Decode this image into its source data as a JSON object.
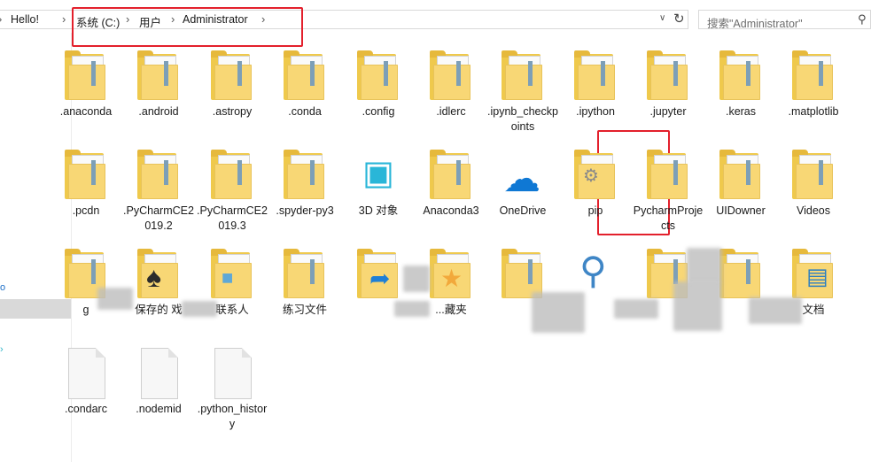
{
  "breadcrumb": {
    "root": "Hello!",
    "drive": "系统 (C:)",
    "users": "用户",
    "folder": "Administrator"
  },
  "search": {
    "placeholder": "搜索\"Administrator\""
  },
  "items": [
    {
      "name": ".anaconda",
      "icon": "folder-icon"
    },
    {
      "name": ".android",
      "icon": "folder-icon"
    },
    {
      "name": ".astropy",
      "icon": "folder-icon"
    },
    {
      "name": ".conda",
      "icon": "folder-icon"
    },
    {
      "name": ".config",
      "icon": "folder-icon"
    },
    {
      "name": ".idlerc",
      "icon": "folder-icon"
    },
    {
      "name": ".ipynb_checkpoints",
      "icon": "folder-icon"
    },
    {
      "name": ".ipython",
      "icon": "folder-icon"
    },
    {
      "name": ".jupyter",
      "icon": "folder-icon"
    },
    {
      "name": ".keras",
      "icon": "folder-icon"
    },
    {
      "name": ".matplotlib",
      "icon": "folder-icon"
    },
    {
      "name": ".pcdn",
      "icon": "folder-icon"
    },
    {
      "name": ".PyCharmCE2019.2",
      "icon": "folder-icon"
    },
    {
      "name": ".PyCharmCE2019.3",
      "icon": "folder-icon"
    },
    {
      "name": ".spyder-py3",
      "icon": "folder-icon"
    },
    {
      "name": "3D 对象",
      "icon": "3d-objects-icon"
    },
    {
      "name": "Anaconda3",
      "icon": "folder-icon"
    },
    {
      "name": "OneDrive",
      "icon": "onedrive-icon"
    },
    {
      "name": "pip",
      "icon": "folder-gear-icon"
    },
    {
      "name": "PycharmProjects",
      "icon": "folder-icon"
    },
    {
      "name": "UIDowner",
      "icon": "folder-icon"
    },
    {
      "name": "Videos",
      "icon": "folder-icon"
    },
    {
      "name": "g",
      "icon": "folder-icon"
    },
    {
      "name": "保存的  戏",
      "icon": "saved-games-icon"
    },
    {
      "name": "联系人",
      "icon": "contacts-icon"
    },
    {
      "name": "练习文件",
      "icon": "folder-icon"
    },
    {
      "name": "",
      "icon": "links-icon"
    },
    {
      "name": "...藏夹",
      "icon": "favorites-icon"
    },
    {
      "name": "",
      "icon": "folder-icon"
    },
    {
      "name": "",
      "icon": "searches-icon"
    },
    {
      "name": "",
      "icon": "folder-icon"
    },
    {
      "name": "",
      "icon": "folder-icon"
    },
    {
      "name": "文档",
      "icon": "documents-icon"
    },
    {
      "name": ".condarc",
      "icon": "file-icon"
    },
    {
      "name": ".nodemid",
      "icon": "file-icon"
    },
    {
      "name": ".python_history",
      "icon": "file-icon"
    }
  ],
  "colors": {
    "highlight_box": "#e3202c",
    "folder": "#f8d775"
  }
}
